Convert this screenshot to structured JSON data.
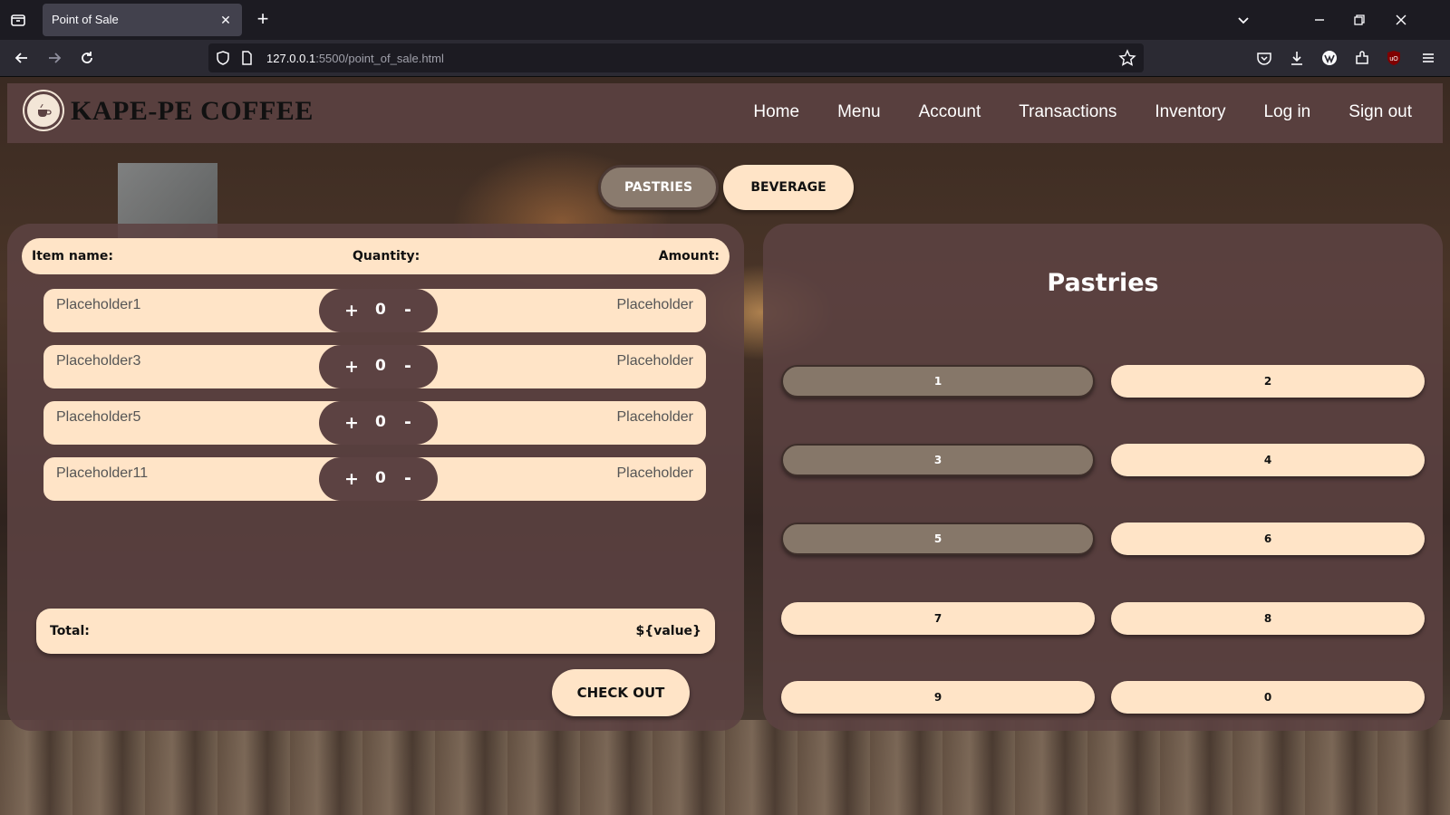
{
  "browser": {
    "tab_title": "Point of Sale",
    "url_host": "127.0.0.1",
    "url_rest": ":5500/point_of_sale.html"
  },
  "header": {
    "brand": "KAPE-PE COFFEE",
    "menu": [
      "Home",
      "Menu",
      "Account",
      "Transactions",
      "Inventory",
      "Log in",
      "Sign out"
    ]
  },
  "categories": {
    "pastries": "PASTRIES",
    "beverage": "BEVERAGE",
    "active": "PASTRIES"
  },
  "order": {
    "headers": {
      "item": "Item name:",
      "quantity": "Quantity:",
      "amount": "Amount:"
    },
    "rows": [
      {
        "name": "Placeholder1",
        "qty": "0",
        "amount": "Placeholder"
      },
      {
        "name": "Placeholder3",
        "qty": "0",
        "amount": "Placeholder"
      },
      {
        "name": "Placeholder5",
        "qty": "0",
        "amount": "Placeholder"
      },
      {
        "name": "Placeholder11",
        "qty": "0",
        "amount": "Placeholder"
      }
    ],
    "stepper": {
      "plus": "+",
      "minus": "-"
    },
    "total_label": "Total:",
    "total_value": "${value}",
    "checkout": "CHECK OUT"
  },
  "products": {
    "title": "Pastries",
    "buttons": [
      "1",
      "2",
      "3",
      "4",
      "5",
      "6",
      "7",
      "8",
      "9",
      "0"
    ],
    "selected": [
      "1",
      "3",
      "5"
    ]
  }
}
